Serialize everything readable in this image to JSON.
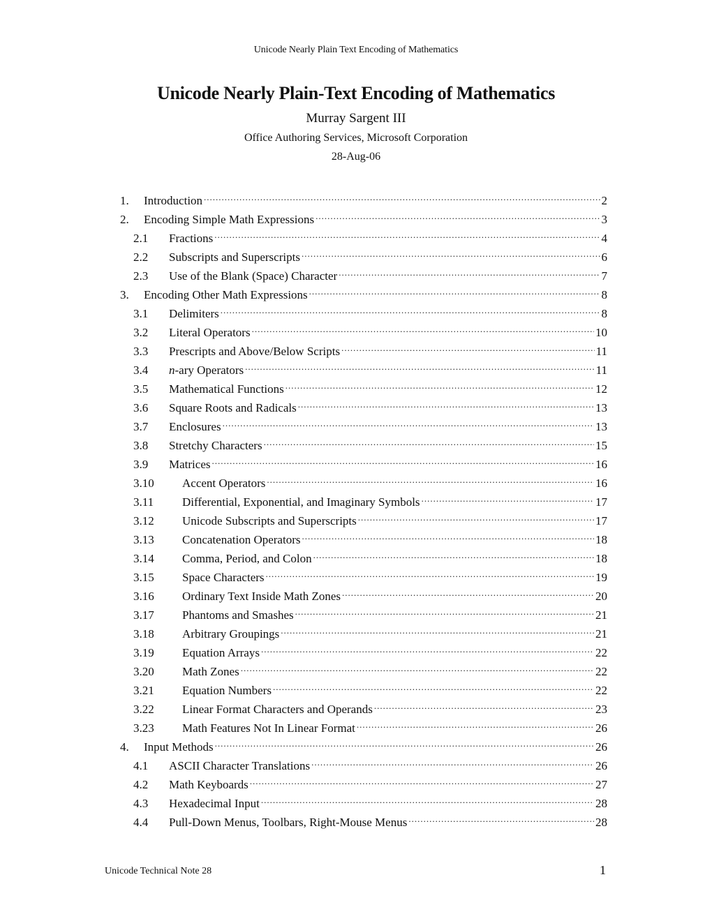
{
  "header": {
    "running_title": "Unicode Nearly Plain Text Encoding of Mathematics"
  },
  "title_block": {
    "title": "Unicode Nearly Plain-Text Encoding of Mathematics",
    "author": "Murray Sargent III",
    "affiliation": "Office Authoring Services, Microsoft Corporation",
    "date": "28-Aug-06"
  },
  "toc": [
    {
      "num": "1.",
      "label": "Introduction",
      "page": "2",
      "level": 1
    },
    {
      "num": "2.",
      "label": "Encoding Simple Math Expressions",
      "page": "3",
      "level": 1
    },
    {
      "num": "2.1",
      "label": "Fractions",
      "page": "4",
      "level": 2
    },
    {
      "num": "2.2",
      "label": "Subscripts and Superscripts",
      "page": "6",
      "level": 2
    },
    {
      "num": "2.3",
      "label": "Use of the Blank (Space) Character",
      "page": "7",
      "level": 2
    },
    {
      "num": "3.",
      "label": "Encoding Other Math Expressions",
      "page": "8",
      "level": 1
    },
    {
      "num": "3.1",
      "label": "Delimiters",
      "page": "8",
      "level": 2
    },
    {
      "num": "3.2",
      "label": "Literal Operators",
      "page": "10",
      "level": 2
    },
    {
      "num": "3.3",
      "label": "Prescripts and Above/Below Scripts",
      "page": "11",
      "level": 2
    },
    {
      "num": "3.4",
      "label_italic": "n",
      "label": "-ary Operators",
      "page": "11",
      "level": 2
    },
    {
      "num": "3.5",
      "label": "Mathematical Functions",
      "page": "12",
      "level": 2
    },
    {
      "num": "3.6",
      "label": "Square Roots and Radicals",
      "page": "13",
      "level": 2
    },
    {
      "num": "3.7",
      "label": "Enclosures",
      "page": "13",
      "level": 2
    },
    {
      "num": "3.8",
      "label": "Stretchy Characters",
      "page": "15",
      "level": 2
    },
    {
      "num": "3.9",
      "label": "Matrices",
      "page": "16",
      "level": 2
    },
    {
      "num": "3.10",
      "label": "Accent Operators",
      "page": "16",
      "level": 3
    },
    {
      "num": "3.11",
      "label": "Differential, Exponential, and Imaginary Symbols",
      "page": "17",
      "level": 3
    },
    {
      "num": "3.12",
      "label": "Unicode Subscripts and Superscripts",
      "page": "17",
      "level": 3
    },
    {
      "num": "3.13",
      "label": "Concatenation Operators",
      "page": "18",
      "level": 3
    },
    {
      "num": "3.14",
      "label": "Comma, Period, and Colon",
      "page": "18",
      "level": 3
    },
    {
      "num": "3.15",
      "label": "Space Characters",
      "page": "19",
      "level": 3
    },
    {
      "num": "3.16",
      "label": "Ordinary Text Inside Math Zones",
      "page": "20",
      "level": 3
    },
    {
      "num": "3.17",
      "label": "Phantoms and Smashes",
      "page": "21",
      "level": 3
    },
    {
      "num": "3.18",
      "label": "Arbitrary Groupings",
      "page": "21",
      "level": 3
    },
    {
      "num": "3.19",
      "label": "Equation Arrays",
      "page": "22",
      "level": 3
    },
    {
      "num": "3.20",
      "label": "Math Zones",
      "page": "22",
      "level": 3
    },
    {
      "num": "3.21",
      "label": "Equation Numbers",
      "page": "22",
      "level": 3
    },
    {
      "num": "3.22",
      "label": "Linear Format Characters and Operands",
      "page": "23",
      "level": 3
    },
    {
      "num": "3.23",
      "label": "Math Features Not In Linear Format",
      "page": "26",
      "level": 3
    },
    {
      "num": "4.",
      "label": "Input Methods",
      "page": "26",
      "level": 1
    },
    {
      "num": "4.1",
      "label": "ASCII Character Translations",
      "page": "26",
      "level": 2
    },
    {
      "num": "4.2",
      "label": "Math Keyboards",
      "page": "27",
      "level": 2
    },
    {
      "num": "4.3",
      "label": "Hexadecimal Input",
      "page": "28",
      "level": 2
    },
    {
      "num": "4.4",
      "label": "Pull-Down Menus, Toolbars, Right-Mouse Menus",
      "page": "28",
      "level": 2
    }
  ],
  "footer": {
    "left": "Unicode Technical Note 28",
    "page_number": "1"
  }
}
